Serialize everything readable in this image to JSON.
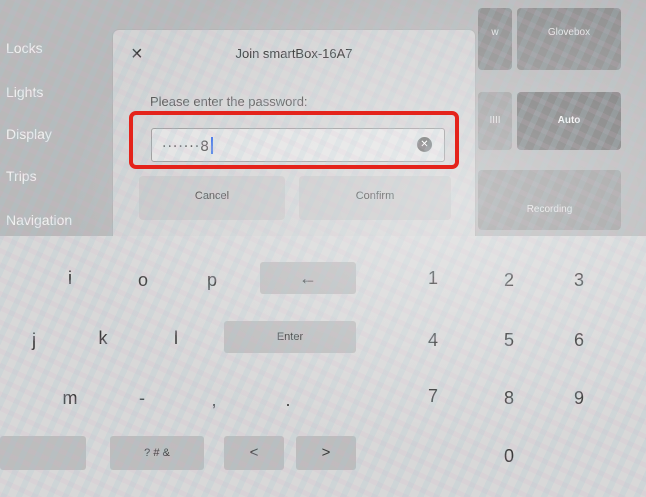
{
  "side_menu": [
    "Locks",
    "Lights",
    "Display",
    "Trips",
    "Navigation"
  ],
  "bg_tiles": {
    "glovebox": "Glovebox",
    "cut_w": "w",
    "bars": "IIII",
    "auto": "Auto",
    "recording": "Recording"
  },
  "dialog": {
    "close": "×",
    "title": "Join smartBox-16A7",
    "prompt": "Please enter the password:",
    "password_value": "·······8",
    "cancel": "Cancel",
    "confirm": "Confirm"
  },
  "keyboard": {
    "row1_letters": [
      "i",
      "o",
      "p"
    ],
    "backspace": "←",
    "row2_letters": [
      "j",
      "k",
      "l"
    ],
    "enter": "Enter",
    "row3_chars": [
      "m",
      "-",
      ",",
      "."
    ],
    "symbols": "? # &",
    "left": "<",
    "right": ">",
    "numbers": [
      "1",
      "2",
      "3",
      "4",
      "5",
      "6",
      "7",
      "8",
      "9",
      "0"
    ]
  },
  "colors": {
    "highlight": "#e4231b",
    "caret": "#3b6ee8"
  }
}
